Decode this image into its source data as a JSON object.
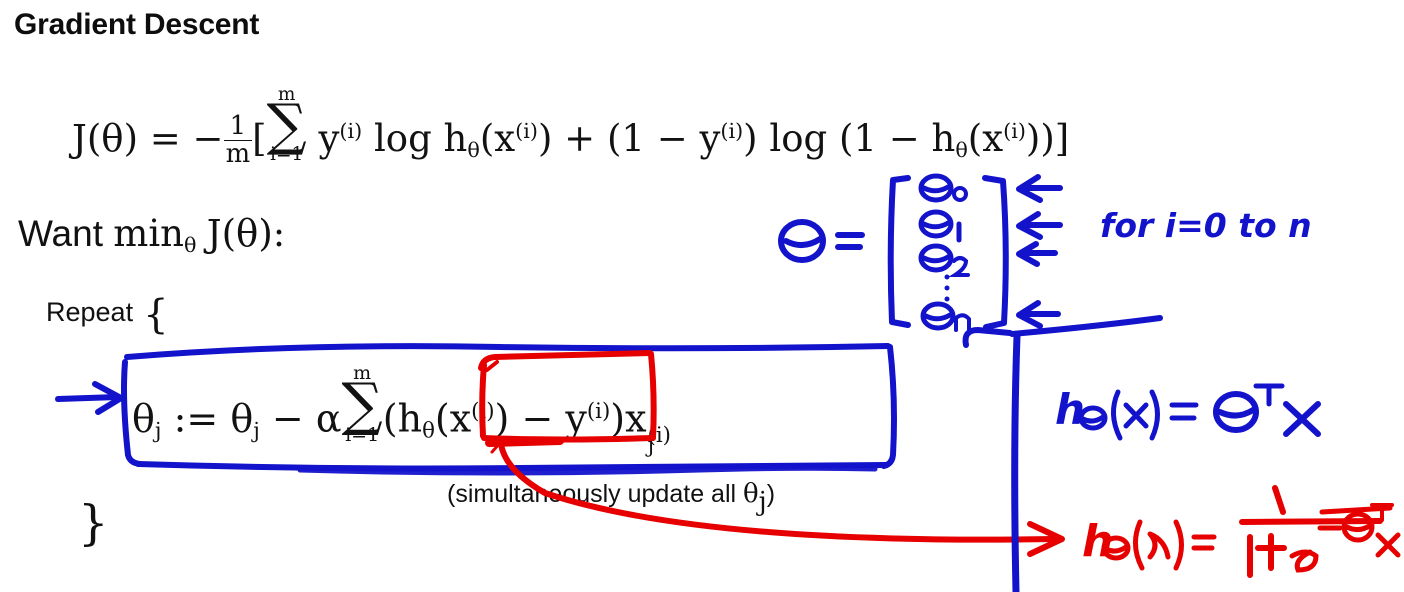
{
  "slide": {
    "title": "Gradient Descent",
    "background_color": "#ffffff",
    "ink_blue": "#1313cc",
    "ink_red": "#e60000",
    "text_color": "#111111"
  },
  "printed": {
    "cost_function": {
      "lhs": "J(θ)",
      "equals": "=",
      "expression": "− (1/m) [ ∑_{i=1}^{m} y^{(i)} log h_θ(x^{(i)}) + (1 − y^{(i)}) log (1 − h_θ(x^{(i)})) ]",
      "pieces": {
        "J": "J",
        "theta": "θ",
        "eq": "=",
        "minus": "−",
        "one": "1",
        "m": "m",
        "lbracket": "[",
        "rbracket": "]",
        "sigma": "∑",
        "sum_upper": "m",
        "sum_lower": "i=1",
        "y": "y",
        "sup_i": "(i)",
        "log": "log",
        "h": "h",
        "x": "x",
        "plus": "+",
        "lparen": "(",
        "rparen": ")"
      }
    },
    "want_line": {
      "word": "Want",
      "min": "min",
      "min_sub": "θ",
      "obj": "J(θ):"
    },
    "repeat_label": "Repeat",
    "open_brace": "{",
    "close_brace": "}",
    "update_rule": {
      "text": "θ_j := θ_j − α ∑_{i=1}^{m} ( h_θ(x^{(i)}) − y^{(i)} ) x_j^{(i)}",
      "pieces": {
        "theta": "θ",
        "sub_j": "j",
        "assign": ":=",
        "minus": "−",
        "alpha": "α",
        "sigma": "∑",
        "sum_upper": "m",
        "sum_lower": "i=1",
        "h": "h",
        "x": "x",
        "y": "y",
        "sup_i": "(i)",
        "lparen": "(",
        "rparen": ")"
      }
    },
    "simultaneous_note": {
      "prefix": "(simultaneously update all ",
      "symbol": "θ",
      "sub": "j",
      "suffix": ")"
    }
  },
  "annotations": {
    "theta_vector": {
      "color": "#1313cc",
      "lhs_symbol": "Θ",
      "equals": "=",
      "left_bracket": "[",
      "right_bracket": "]",
      "entries": [
        "Θ0",
        "Θ1",
        "Θ2",
        "⋮",
        "Θn"
      ],
      "arrow_count": 4,
      "arrow_glyph": "←"
    },
    "for_loop_note": {
      "color": "#1313cc",
      "text": "for  i=0 to n"
    },
    "hypothesis_linear": {
      "color": "#1313cc",
      "text": "hθ(x) = Θᵀx"
    },
    "hypothesis_sigmoid": {
      "color": "#e60000",
      "lhs": "hθ(x) =",
      "numerator": "1",
      "denominator": "1+e⁻Θᵀˣ"
    },
    "blue_box_label": "box-around-update-rule",
    "red_box_label": "box-around-hypothesis-term",
    "blue_arrow_label": "arrow-pointing-at-update-rule",
    "red_curve_label": "arrow-from-hypothesis-to-sigmoid",
    "blue_divider_label": "vertical-divider-line"
  }
}
